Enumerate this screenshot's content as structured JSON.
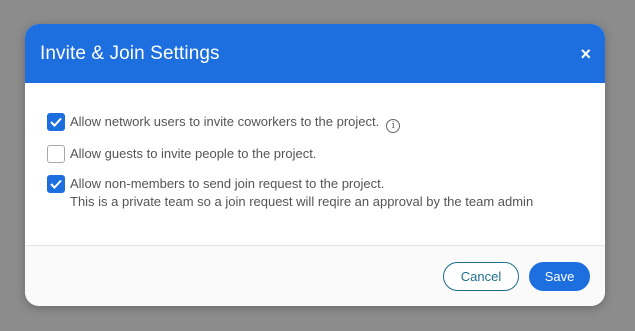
{
  "dialog": {
    "title": "Invite & Join Settings",
    "close_glyph": "×",
    "options": [
      {
        "checked": true,
        "label": "Allow network users to invite coworkers to the project.",
        "has_info_icon": true
      },
      {
        "checked": false,
        "label": "Allow guests to invite people to the project."
      },
      {
        "checked": true,
        "label": "Allow non-members to send join request to the project.",
        "sublabel": "This is a private team so a join request will reqire an approval by the team admin"
      }
    ],
    "info_glyph": "i",
    "cancel_label": "Cancel",
    "save_label": "Save"
  },
  "colors": {
    "accent": "#1d6fe0",
    "cancel_border": "#1f6e8c",
    "backdrop": "#8c8c8c"
  }
}
